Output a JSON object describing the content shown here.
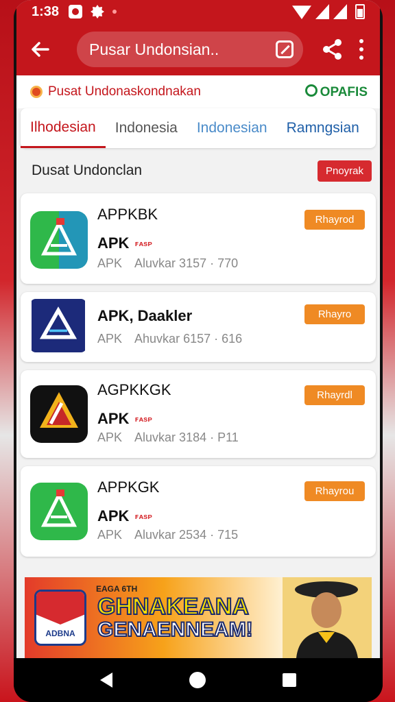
{
  "status_bar": {
    "time": "1:38"
  },
  "app_bar": {
    "url": "Pusar Undonsian.."
  },
  "site_header": {
    "title": "Pusat Undonaskondnakan",
    "brand": "OPAFIS"
  },
  "tabs": [
    {
      "label": "Ilhodesian",
      "state": "active"
    },
    {
      "label": "Indonesia"
    },
    {
      "label": "Indonesian"
    },
    {
      "label": "Ramngsian"
    }
  ],
  "section": {
    "title": "Dusat Undonclan",
    "button": "Pnoyrak"
  },
  "apps": [
    {
      "name": "APPKBK",
      "type": "APK",
      "badge": "ꜰᴀsᴘ",
      "meta_a": "APK",
      "meta_b": "Aluvkar 3157 · 770",
      "button": "Rhayrod",
      "icon": "green-a-icon"
    },
    {
      "name": "APK, Daakler",
      "type": "",
      "badge": "",
      "meta_a": "APK",
      "meta_b": "Ahuvkar 6157 · 616",
      "button": "Rhayro",
      "icon": "navy-a-icon"
    },
    {
      "name": "AGPKKGK",
      "type": "APK",
      "badge": "ꜰᴀsᴘ",
      "meta_a": "APK",
      "meta_b": "Aluvkar 3184 · P11",
      "button": "Rhayrdl",
      "icon": "dark-a-icon"
    },
    {
      "name": "APPKGK",
      "type": "APK",
      "badge": "ꜰᴀsᴘ",
      "meta_a": "APK",
      "meta_b": "Aluvkar 2534 · 715",
      "button": "Rhayrou",
      "icon": "green-a-icon"
    }
  ],
  "banner": {
    "small": "EAGA 6TH",
    "line1": "GHNAKEANA",
    "line2": "GENAENNEAM!",
    "logo_text": "ADBNA"
  },
  "colors": {
    "brand_red": "#c4161c",
    "button_orange": "#ef8a24",
    "brand_green": "#1a8a3a"
  }
}
